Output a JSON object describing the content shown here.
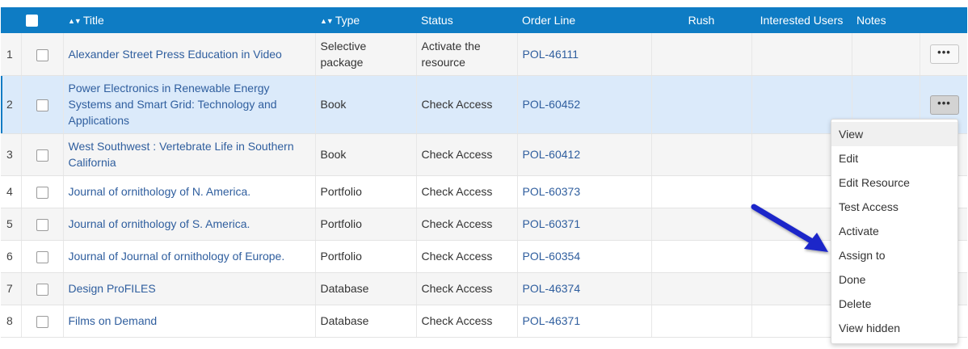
{
  "columns": {
    "title": "Title",
    "type": "Type",
    "status": "Status",
    "order_line": "Order Line",
    "rush": "Rush",
    "interested_users": "Interested Users",
    "notes": "Notes"
  },
  "rows": [
    {
      "num": "1",
      "title": "Alexander Street Press Education in Video",
      "type": "Selective package",
      "status": "Activate the resource",
      "order_line": "POL-46111"
    },
    {
      "num": "2",
      "title": "Power Electronics in Renewable Energy Systems and Smart Grid: Technology and Applications",
      "type": "Book",
      "status": "Check Access",
      "order_line": "POL-60452"
    },
    {
      "num": "3",
      "title": "West Southwest : Vertebrate Life in Southern California",
      "type": "Book",
      "status": "Check Access",
      "order_line": "POL-60412"
    },
    {
      "num": "4",
      "title": "Journal of ornithology of N. America.",
      "type": "Portfolio",
      "status": "Check Access",
      "order_line": "POL-60373"
    },
    {
      "num": "5",
      "title": "Journal of ornithology of S. America.",
      "type": "Portfolio",
      "status": "Check Access",
      "order_line": "POL-60371"
    },
    {
      "num": "6",
      "title": "Journal of Journal of ornithology of Europe.",
      "type": "Portfolio",
      "status": "Check Access",
      "order_line": "POL-60354"
    },
    {
      "num": "7",
      "title": "Design ProFILES",
      "type": "Database",
      "status": "Check Access",
      "order_line": "POL-46374"
    },
    {
      "num": "8",
      "title": "Films on Demand",
      "type": "Database",
      "status": "Check Access",
      "order_line": "POL-46371"
    }
  ],
  "row_actions_label": "•••",
  "menu": {
    "items": [
      "View",
      "Edit",
      "Edit Resource",
      "Test Access",
      "Activate",
      "Assign to",
      "Done",
      "Delete",
      "View hidden"
    ]
  },
  "colors": {
    "header_bg": "#0e7cc4",
    "link": "#2f5e9e",
    "selected_row": "#dbeafa",
    "arrow": "#1d27c9"
  },
  "icons": {
    "sort": "sort-arrows-icon",
    "more": "more-actions-icon",
    "pointer": "pointer-arrow-icon"
  }
}
